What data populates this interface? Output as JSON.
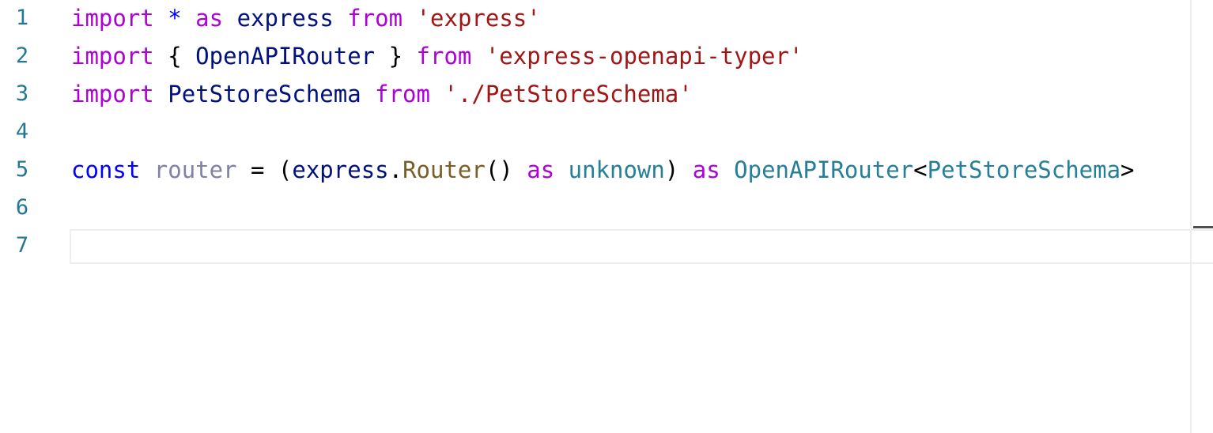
{
  "editor": {
    "colors": {
      "keyword": "#af00db",
      "storage": "#0000ff",
      "identifier": "#001080",
      "string": "#a31515",
      "type": "#267f99",
      "function": "#795e26",
      "unused": "#8080a8",
      "default": "#000000",
      "line_number": "#237893"
    },
    "lines": [
      {
        "number": "1",
        "tokens": [
          {
            "text": "import",
            "kind": "keyword"
          },
          {
            "text": " ",
            "kind": "default"
          },
          {
            "text": "*",
            "kind": "storage"
          },
          {
            "text": " ",
            "kind": "default"
          },
          {
            "text": "as",
            "kind": "keyword"
          },
          {
            "text": " ",
            "kind": "default"
          },
          {
            "text": "express",
            "kind": "identifier"
          },
          {
            "text": " ",
            "kind": "default"
          },
          {
            "text": "from",
            "kind": "keyword"
          },
          {
            "text": " ",
            "kind": "default"
          },
          {
            "text": "'express'",
            "kind": "string"
          }
        ]
      },
      {
        "number": "2",
        "tokens": [
          {
            "text": "import",
            "kind": "keyword"
          },
          {
            "text": " { ",
            "kind": "default"
          },
          {
            "text": "OpenAPIRouter",
            "kind": "identifier"
          },
          {
            "text": " } ",
            "kind": "default"
          },
          {
            "text": "from",
            "kind": "keyword"
          },
          {
            "text": " ",
            "kind": "default"
          },
          {
            "text": "'express-openapi-typer'",
            "kind": "string"
          }
        ]
      },
      {
        "number": "3",
        "tokens": [
          {
            "text": "import",
            "kind": "keyword"
          },
          {
            "text": " ",
            "kind": "default"
          },
          {
            "text": "PetStoreSchema",
            "kind": "identifier"
          },
          {
            "text": " ",
            "kind": "default"
          },
          {
            "text": "from",
            "kind": "keyword"
          },
          {
            "text": " ",
            "kind": "default"
          },
          {
            "text": "'./PetStoreSchema'",
            "kind": "string"
          }
        ]
      },
      {
        "number": "4",
        "tokens": []
      },
      {
        "number": "5",
        "tokens": [
          {
            "text": "const",
            "kind": "storage"
          },
          {
            "text": " ",
            "kind": "default"
          },
          {
            "text": "router",
            "kind": "unused"
          },
          {
            "text": " = (",
            "kind": "default"
          },
          {
            "text": "express",
            "kind": "identifier"
          },
          {
            "text": ".",
            "kind": "default"
          },
          {
            "text": "Router",
            "kind": "function"
          },
          {
            "text": "() ",
            "kind": "default"
          },
          {
            "text": "as",
            "kind": "keyword"
          },
          {
            "text": " ",
            "kind": "default"
          },
          {
            "text": "unknown",
            "kind": "type"
          },
          {
            "text": ") ",
            "kind": "default"
          },
          {
            "text": "as",
            "kind": "keyword"
          },
          {
            "text": " ",
            "kind": "default"
          },
          {
            "text": "OpenAPIRouter",
            "kind": "type"
          },
          {
            "text": "<",
            "kind": "default"
          },
          {
            "text": "PetStoreSchema",
            "kind": "type"
          },
          {
            "text": ">",
            "kind": "default"
          }
        ]
      },
      {
        "number": "6",
        "tokens": []
      },
      {
        "number": "7",
        "tokens": []
      }
    ],
    "current_line": 7
  }
}
